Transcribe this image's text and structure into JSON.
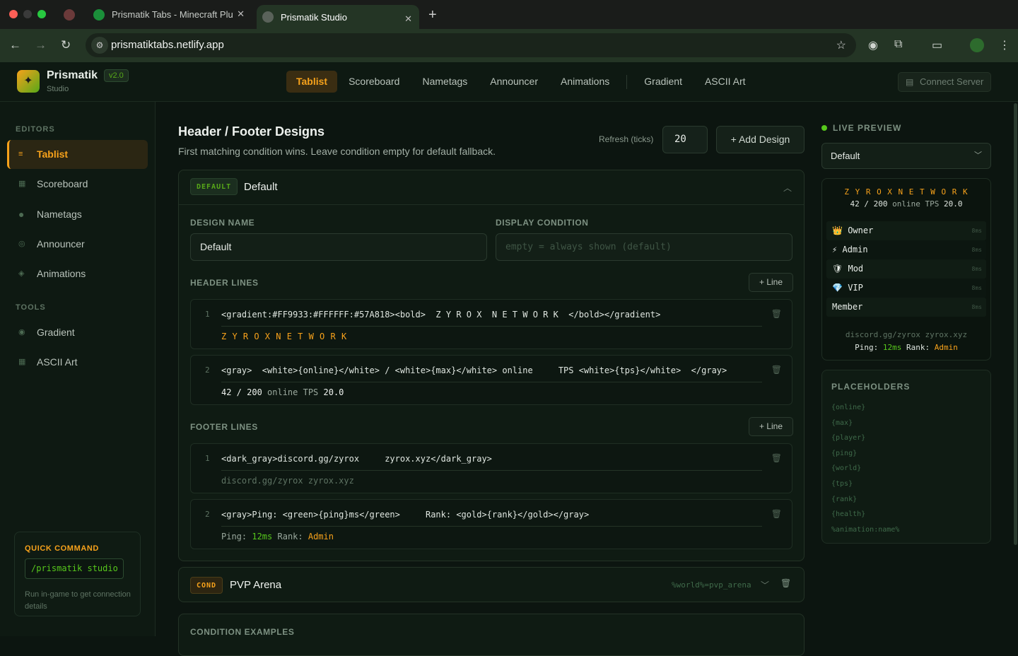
{
  "browser": {
    "tabs": [
      {
        "title": ""
      },
      {
        "title": "Prismatik Tabs - Minecraft Plu"
      },
      {
        "title": "Prismatik Studio"
      }
    ],
    "url": "prismatiktabs.netlify.app"
  },
  "app": {
    "brand": "Prismatik",
    "studio": "Studio",
    "version": "v2.0",
    "nav": [
      "Tablist",
      "Scoreboard",
      "Nametags",
      "Announcer",
      "Animations",
      "Gradient",
      "ASCII Art"
    ],
    "connect_label": "Connect Server"
  },
  "sidebar": {
    "editors_label": "EDITORS",
    "editors": [
      "Tablist",
      "Scoreboard",
      "Nametags",
      "Announcer",
      "Animations"
    ],
    "tools_label": "TOOLS",
    "tools": [
      "Gradient",
      "ASCII Art"
    ],
    "quick": {
      "title": "QUICK COMMAND",
      "command": "/prismatik studio",
      "desc": "Run in-game to get connection details"
    }
  },
  "main": {
    "title": "Header / Footer Designs",
    "subtitle": "First matching condition wins. Leave condition empty for default fallback.",
    "refresh_label": "Refresh (ticks)",
    "refresh_value": "20",
    "add_label": "Add Design",
    "design": {
      "badge": "DEFAULT",
      "title": "Default",
      "name_label": "DESIGN NAME",
      "name_value": "Default",
      "cond_label": "DISPLAY CONDITION",
      "cond_placeholder": "empty = always shown (default)",
      "header_label": "HEADER LINES",
      "footer_label": "FOOTER LINES",
      "line_btn": "Line",
      "header_lines": [
        {
          "num": "1",
          "code": "<gradient:#FF9933:#FFFFFF:#57A818><bold>  Z Y R O X  N E T W O R K  </bold></gradient>"
        },
        {
          "num": "2",
          "code": "<gray>  <white>{online}</white> / <white>{max}</white> online     TPS <white>{tps}</white>  </gray>",
          "preview_a": "42 / 200",
          "preview_b": " online TPS ",
          "preview_c": "20.0"
        }
      ],
      "footer_lines": [
        {
          "num": "1",
          "code": "<dark_gray>discord.gg/zyrox     zyrox.xyz</dark_gray>",
          "preview": "discord.gg/zyrox zyrox.xyz"
        },
        {
          "num": "2",
          "code": "<gray>Ping: <green>{ping}ms</green>     Rank: <gold>{rank}</gold></gray>",
          "preview_a": "Ping: ",
          "preview_b": "12ms",
          "preview_c": " Rank: ",
          "preview_d": "Admin"
        }
      ]
    },
    "design2": {
      "badge": "COND",
      "title": "PVP Arena",
      "condition": "%world%=pvp_arena"
    },
    "examples_label": "CONDITION EXAMPLES"
  },
  "preview": {
    "title": "LIVE PREVIEW",
    "select": "Default",
    "header1": "Z Y R O X N E T W O R K",
    "header2a": "42 / 200",
    "header2b": " online TPS ",
    "header2c": "20.0",
    "players": [
      {
        "icon": "👑",
        "name": "Owner",
        "ms": "8ms"
      },
      {
        "icon": "⚡",
        "name": "Admin",
        "ms": "8ms"
      },
      {
        "icon": "🛡",
        "name": "Mod",
        "ms": "8ms"
      },
      {
        "icon": "💎",
        "name": "VIP",
        "ms": "8ms"
      },
      {
        "icon": "",
        "name": "Member",
        "ms": "8ms"
      }
    ],
    "footer1": "discord.gg/zyrox zyrox.xyz",
    "footer2a": "Ping: ",
    "footer2b": "12ms",
    "footer2c": " Rank: ",
    "footer2d": "Admin"
  },
  "placeholders": {
    "title": "PLACEHOLDERS",
    "items": [
      "{online}",
      "{max}",
      "{player}",
      "{ping}",
      "{world}",
      "{tps}",
      "{rank}",
      "{health}",
      "%animation:name%"
    ]
  },
  "colors": {
    "accent": "#f7a21b",
    "green": "#57a818",
    "bg": "#0c1510"
  }
}
